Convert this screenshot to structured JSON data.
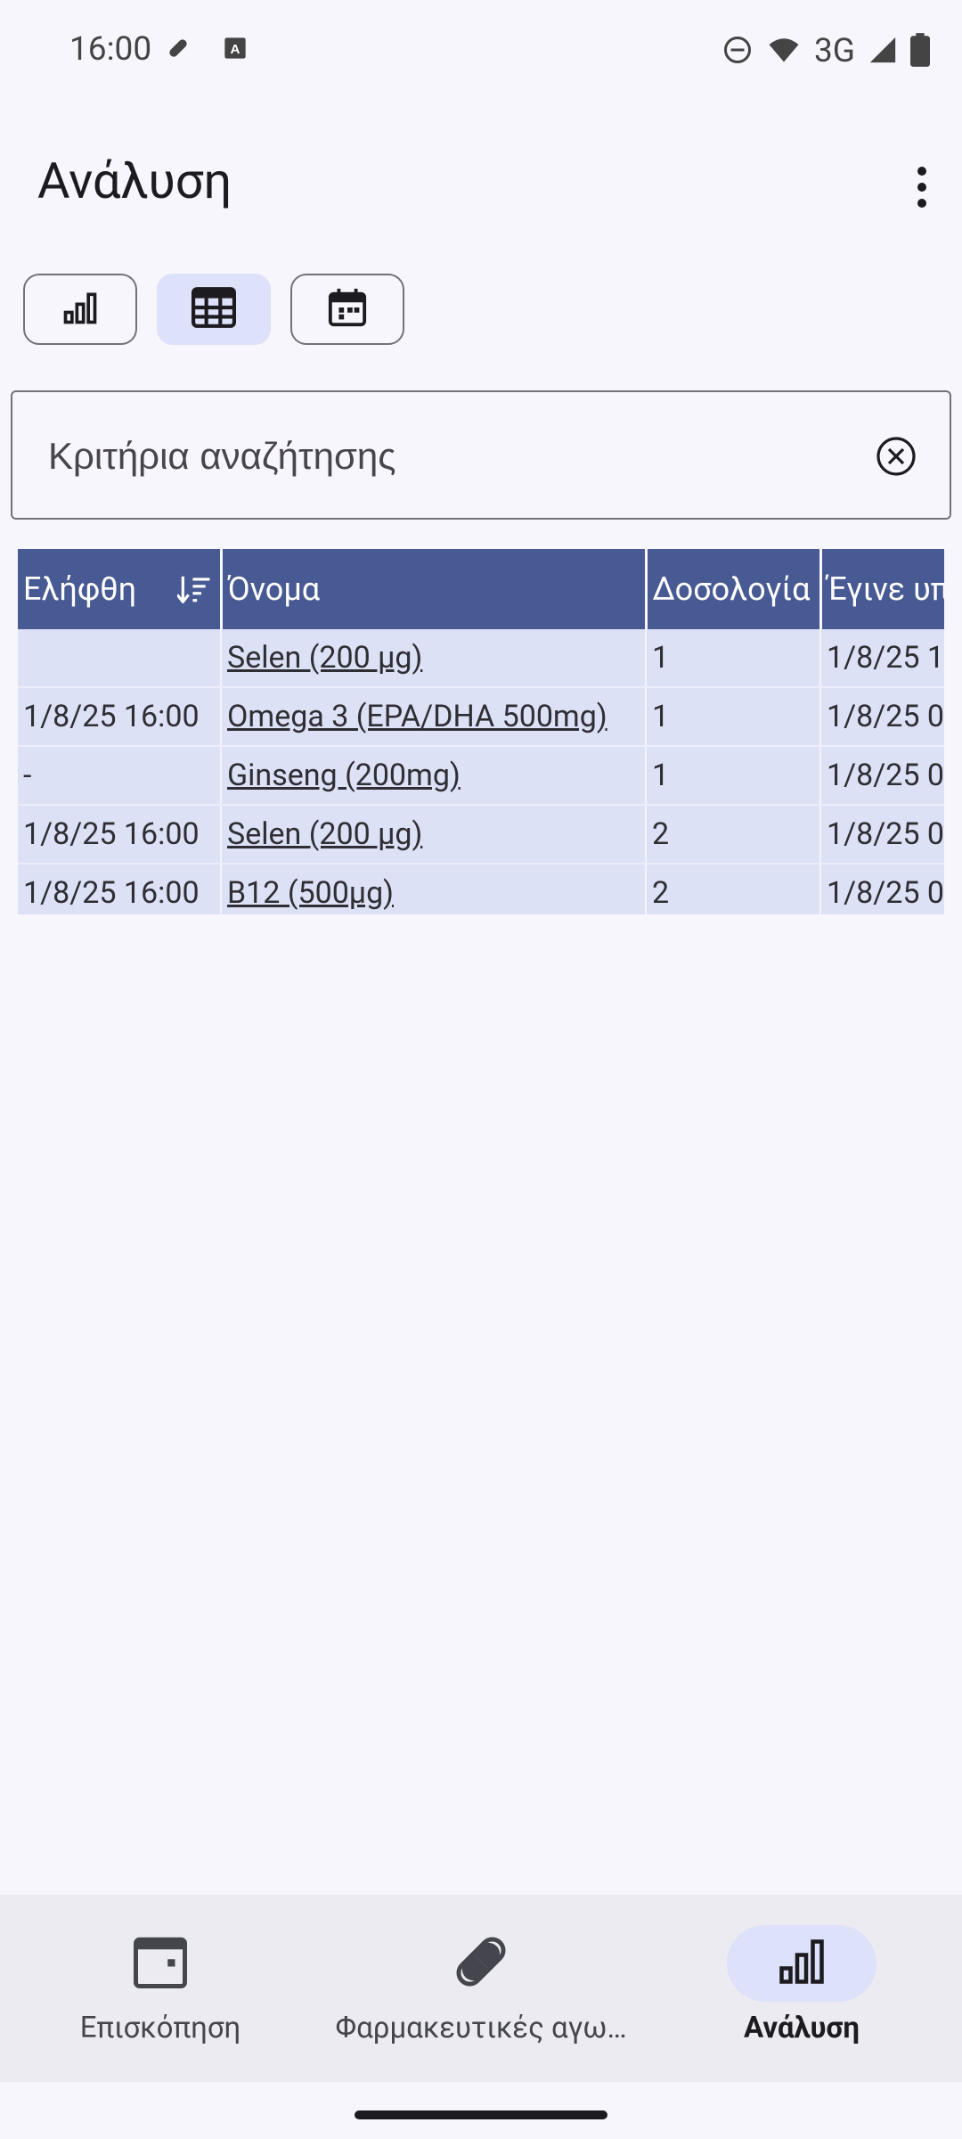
{
  "status_bar": {
    "time": "16:00",
    "left_icons": [
      "pill-icon",
      "a-badge-icon"
    ],
    "right_icons": [
      "dnd-icon",
      "wifi-icon",
      "signal-icon",
      "battery-icon"
    ],
    "network": "3G"
  },
  "app_bar": {
    "title": "Ανάλυση",
    "overflow_icon": "more-vert-icon"
  },
  "view_toggles": [
    {
      "icon": "bar-chart-icon",
      "selected": false
    },
    {
      "icon": "table-icon",
      "selected": true
    },
    {
      "icon": "calendar-icon",
      "selected": false
    }
  ],
  "search": {
    "placeholder": "Κριτήρια αναζήτησης",
    "value": ""
  },
  "table": {
    "columns": [
      "Ελήφθη",
      "Όνομα",
      "Δοσολογία",
      "Έγινε υπ"
    ],
    "rows": [
      {
        "taken": "",
        "name": "Selen (200 µg)",
        "dosage": "1",
        "done": "1/8/25 1"
      },
      {
        "taken": "1/8/25 16:00",
        "name": "Omega 3 (EPA/DHA 500mg)",
        "dosage": "1",
        "done": "1/8/25 0"
      },
      {
        "taken": "-",
        "name": "Ginseng (200mg)",
        "dosage": "1",
        "done": "1/8/25 0"
      },
      {
        "taken": "1/8/25 16:00",
        "name": "Selen (200 µg)",
        "dosage": "2",
        "done": "1/8/25 0"
      },
      {
        "taken": "1/8/25 16:00",
        "name": "B12 (500µg)",
        "dosage": "2",
        "done": "1/8/25 0"
      }
    ]
  },
  "bottom_nav": {
    "items": [
      {
        "label": "Επισκόπηση",
        "icon": "calendar-icon",
        "active": false
      },
      {
        "label": "Φαρμακευτικές αγω…",
        "icon": "pill-icon",
        "active": false
      },
      {
        "label": "Ανάλυση",
        "icon": "bar-chart-icon",
        "active": true
      }
    ]
  },
  "colors": {
    "header_bg": "#485a93",
    "row_bg": "#dde1f5",
    "selected_bg": "#dde1f9",
    "page_bg": "#f7f6fc"
  }
}
